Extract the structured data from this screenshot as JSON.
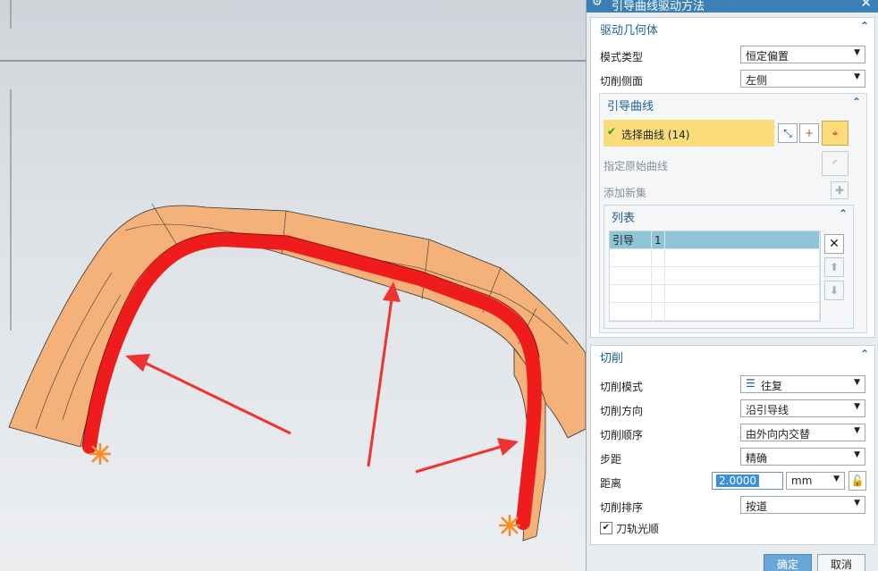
{
  "dialog": {
    "title": "引导曲线驱动方法",
    "gear_icon": "gear-icon",
    "close_icon": "close-icon",
    "drive_geometry": {
      "header": "驱动几何体",
      "mode_type_label": "模式类型",
      "mode_type_value": "恒定偏置",
      "cut_side_label": "切削侧面",
      "cut_side_value": "左侧",
      "guide_curves": {
        "header": "引导曲线",
        "select_curve_label": "选择曲线 (14)",
        "specify_origin_label": "指定原始曲线",
        "add_new_set_label": "添加新集",
        "list": {
          "header": "列表",
          "rows": [
            {
              "name": "引导",
              "index": "1"
            }
          ]
        }
      }
    },
    "cutting": {
      "header": "切削",
      "cut_mode_label": "切削模式",
      "cut_mode_value": "往复",
      "cut_direction_label": "切削方向",
      "cut_direction_value": "沿引导线",
      "cut_order_label": "切削顺序",
      "cut_order_value": "由外向内交替",
      "stepover_label": "步距",
      "stepover_value": "精确",
      "distance_label": "距离",
      "distance_value": "2.0000",
      "distance_unit": "mm",
      "cut_sort_label": "切削排序",
      "cut_sort_value": "按道",
      "smooth_path_label": "刀轨光顺",
      "smooth_path_checked": true
    },
    "ok_label": "确定",
    "cancel_label": "取消"
  },
  "colors": {
    "accent": "#3a7fb6",
    "selected_row": "#8ec5d6",
    "highlight": "#fbdc7a",
    "surface": "#f4b27a",
    "path": "#ee1c1c"
  }
}
